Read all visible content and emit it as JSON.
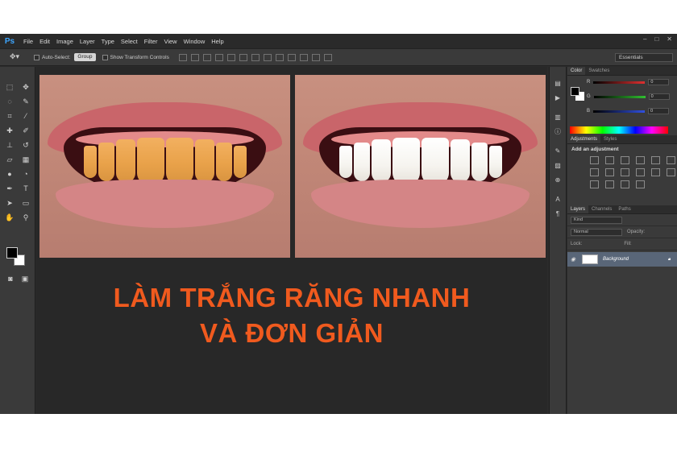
{
  "app": {
    "logo": "Ps",
    "menu": [
      "File",
      "Edit",
      "Image",
      "Layer",
      "Type",
      "Select",
      "Filter",
      "View",
      "Window",
      "Help"
    ],
    "window_controls": [
      "–",
      "□",
      "✕"
    ]
  },
  "options_bar": {
    "auto_select_label": "Auto-Select:",
    "auto_select_value": "Group",
    "transform_label": "Show Transform Controls",
    "workspace": "Essentials"
  },
  "tools": [
    "marquee-tool",
    "move-tool",
    "lasso-tool",
    "quick-select-tool",
    "crop-tool",
    "eyedropper-tool",
    "healing-tool",
    "brush-tool",
    "stamp-tool",
    "history-brush-tool",
    "eraser-tool",
    "gradient-tool",
    "blur-tool",
    "dodge-tool",
    "pen-tool",
    "type-tool",
    "path-select-tool",
    "shape-tool",
    "hand-tool",
    "zoom-tool"
  ],
  "panels": {
    "color_tabs": [
      "Color",
      "Swatches"
    ],
    "color_channels": [
      {
        "label": "R",
        "value": "0",
        "color": "#e03030"
      },
      {
        "label": "G",
        "value": "0",
        "color": "#30c030"
      },
      {
        "label": "B",
        "value": "0",
        "color": "#3050e0"
      }
    ],
    "adjust_tabs": [
      "Adjustments",
      "Styles"
    ],
    "adjust_title": "Add an adjustment",
    "layers_tabs": [
      "Layers",
      "Channels",
      "Paths"
    ],
    "kind_label": "Kind",
    "blend_mode": "Normal",
    "opacity_label": "Opacity:",
    "lock_label": "Lock:",
    "fill_label": "Fill:",
    "layer_name": "Background"
  },
  "canvas": {
    "headline_line1": "LÀM TRẮNG RĂNG NHANH",
    "headline_line2": "VÀ ĐƠN GIẢN",
    "headline_color": "#f05a1e"
  }
}
